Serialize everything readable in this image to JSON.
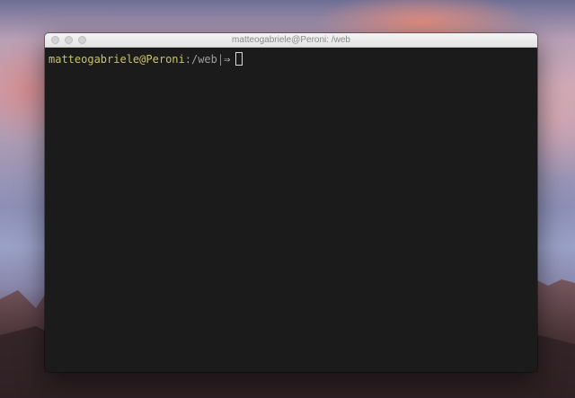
{
  "window": {
    "title": "matteogabriele@Peroni: /web"
  },
  "prompt": {
    "user": "matteogabriele",
    "at": "@",
    "host": "Peroni",
    "colon": ":",
    "path": "/web",
    "separator": "|",
    "arrow": "⇒"
  },
  "colors": {
    "terminal_bg": "#1b1b1b",
    "user_host": "#c8c26a",
    "path": "#9e9e9e",
    "separator": "#d26a7c"
  }
}
